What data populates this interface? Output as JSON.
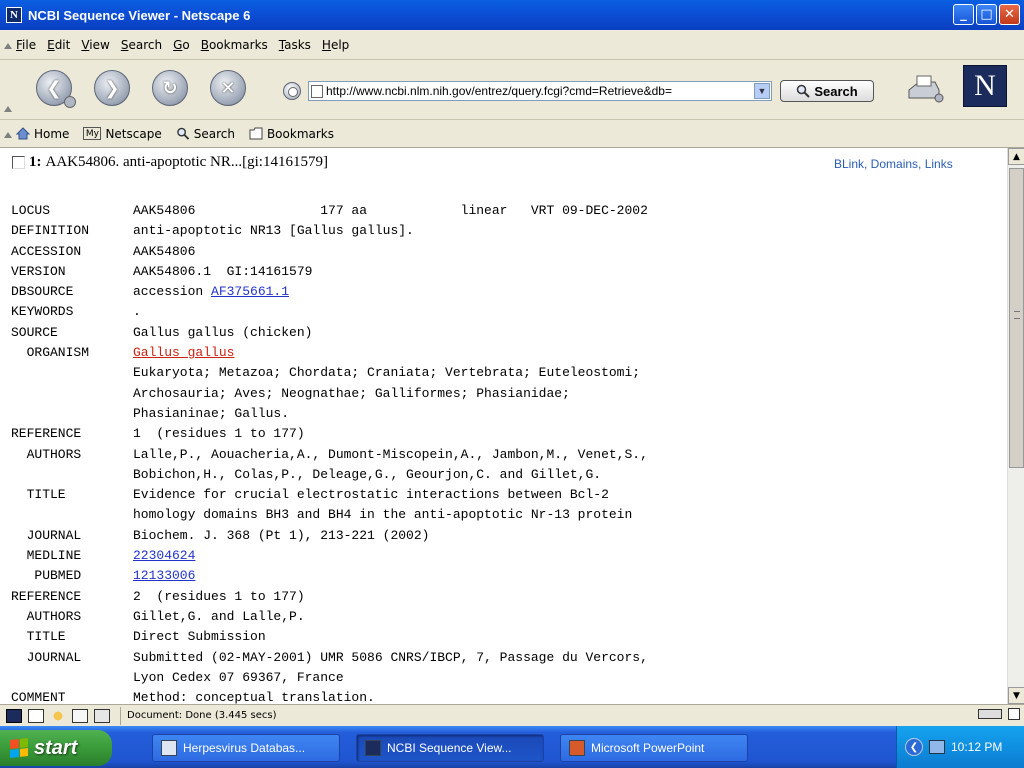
{
  "window": {
    "title": "NCBI Sequence Viewer - Netscape 6",
    "app_icon_letter": "N",
    "buttons": {
      "minimize": "_",
      "maximize": "□",
      "close": "✕"
    }
  },
  "menu": [
    "File",
    "Edit",
    "View",
    "Search",
    "Go",
    "Bookmarks",
    "Tasks",
    "Help"
  ],
  "navigation": {
    "url": "http://www.ncbi.nlm.nih.gov/entrez/query.fcgi?cmd=Retrieve&db=",
    "search_label": "Search",
    "brand_letter": "N"
  },
  "personal_toolbar": {
    "home": "Home",
    "netscape": "Netscape",
    "search": "Search",
    "bookmarks": "Bookmarks"
  },
  "record": {
    "number": "1:",
    "title": "AAK54806. anti-apoptotic NR...[gi:14161579]",
    "links": "BLink, Domains, Links",
    "lines": [
      {
        "key": "LOCUS",
        "value": "AAK54806                177 aa            linear   VRT 09-DEC-2002"
      },
      {
        "key": "DEFINITION",
        "value": "anti-apoptotic NR13 [Gallus gallus]."
      },
      {
        "key": "ACCESSION",
        "value": "AAK54806"
      },
      {
        "key": "VERSION",
        "value": "AAK54806.1  GI:14161579"
      },
      {
        "key": "DBSOURCE",
        "value": "accession ",
        "link": "AF375661.1"
      },
      {
        "key": "KEYWORDS",
        "value": "."
      },
      {
        "key": "SOURCE",
        "value": "Gallus gallus (chicken)"
      },
      {
        "key": "  ORGANISM",
        "value": "",
        "link_red": "Gallus gallus"
      },
      {
        "key": "",
        "value": "Eukaryota; Metazoa; Chordata; Craniata; Vertebrata; Euteleostomi;"
      },
      {
        "key": "",
        "value": "Archosauria; Aves; Neognathae; Galliformes; Phasianidae;"
      },
      {
        "key": "",
        "value": "Phasianinae; Gallus."
      },
      {
        "key": "REFERENCE",
        "value": "1  (residues 1 to 177)"
      },
      {
        "key": "  AUTHORS",
        "value": "Lalle,P., Aouacheria,A., Dumont-Miscopein,A., Jambon,M., Venet,S.,"
      },
      {
        "key": "",
        "value": "Bobichon,H., Colas,P., Deleage,G., Geourjon,C. and Gillet,G."
      },
      {
        "key": "  TITLE",
        "value": "Evidence for crucial electrostatic interactions between Bcl-2"
      },
      {
        "key": "",
        "value": "homology domains BH3 and BH4 in the anti-apoptotic Nr-13 protein"
      },
      {
        "key": "  JOURNAL",
        "value": "Biochem. J. 368 (Pt 1), 213-221 (2002)"
      },
      {
        "key": "  MEDLINE",
        "value": "",
        "link": "22304624"
      },
      {
        "key": "   PUBMED",
        "value": "",
        "link": "12133006"
      },
      {
        "key": "REFERENCE",
        "value": "2  (residues 1 to 177)"
      },
      {
        "key": "  AUTHORS",
        "value": "Gillet,G. and Lalle,P."
      },
      {
        "key": "  TITLE",
        "value": "Direct Submission"
      },
      {
        "key": "  JOURNAL",
        "value": "Submitted (02-MAY-2001) UMR 5086 CNRS/IBCP, 7, Passage du Vercors,"
      },
      {
        "key": "",
        "value": "Lyon Cedex 07 69367, France"
      },
      {
        "key": "COMMENT",
        "value": "Method: conceptual translation."
      }
    ]
  },
  "status": {
    "text": "Document: Done (3.445 secs)"
  },
  "taskbar": {
    "start_label": "start",
    "tasks": [
      "Herpesvirus Databas...",
      "NCBI Sequence View...",
      "Microsoft PowerPoint"
    ],
    "clock": "10:12 PM"
  }
}
